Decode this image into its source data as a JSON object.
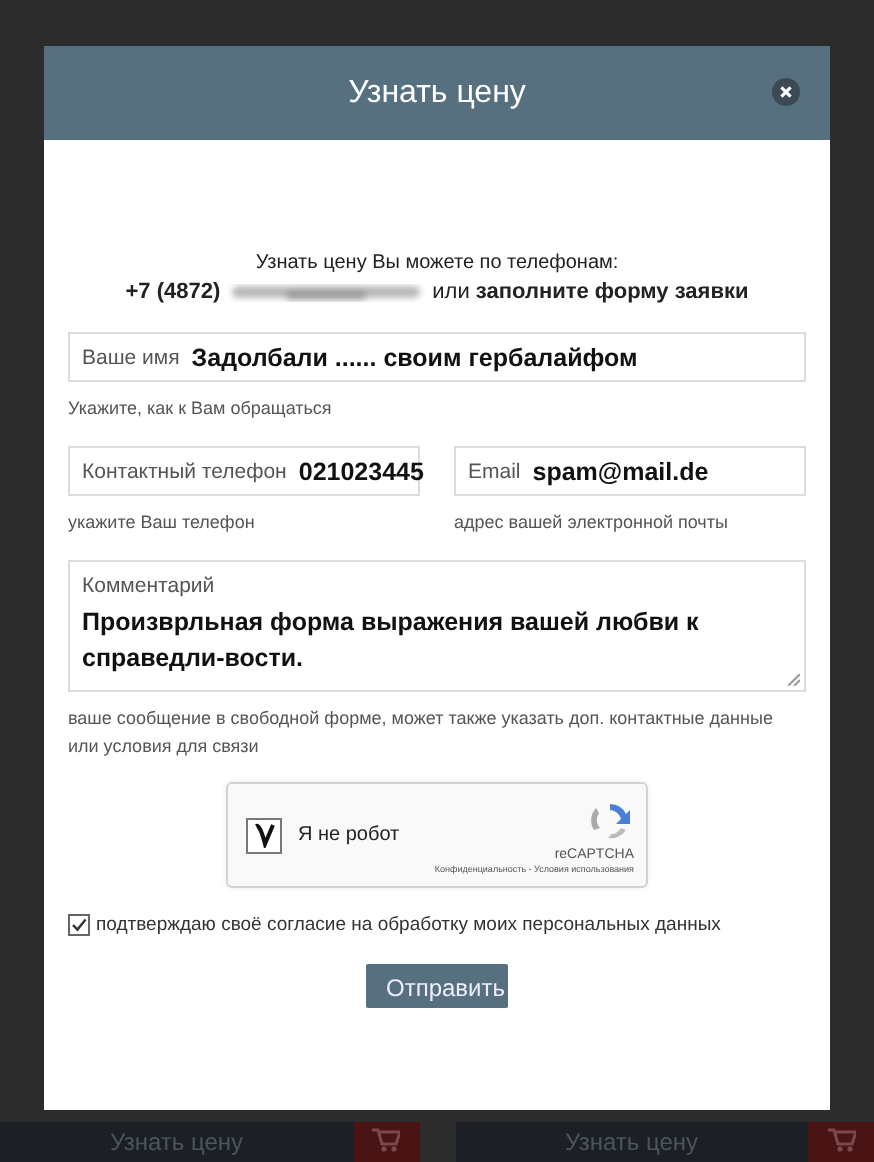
{
  "background": {
    "buttons": [
      {
        "label": "Узнать цену"
      },
      {
        "label": "Узнать цену"
      }
    ]
  },
  "modal": {
    "title": "Узнать цену",
    "intro": "Узнать цену Вы можете по телефонам:",
    "phone": "+7 (4872)",
    "alternative": "или **заполните форму заявки**",
    "field_rows": [
      [
        {
          "kind": "input",
          "label": "Ваше имя",
          "value": "Задолбали ...... своим гербалайфом",
          "hint": "Укажите, как к Вам обращаться"
        }
      ],
      [
        {
          "kind": "input",
          "label": "Контактный телефон",
          "value": "021023445",
          "hint": "укажите Ваш телефон"
        },
        {
          "kind": "input",
          "label": "Email",
          "value": "spam@mail.de",
          "hint": "адрес вашей электронной почты"
        }
      ],
      [
        {
          "kind": "textarea",
          "label": "Комментарий",
          "value": "Произврльная форма выражения вашей любви к справедли-вости.",
          "hint": "ваше сообщение в свободной форме, может также указать доп. контактные данные или условия для связи"
        }
      ]
    ],
    "captcha": {
      "checked": true,
      "label": "Я не робот",
      "brand": "reCAPTCHA",
      "links": "Конфиденциальность - Условия использования"
    },
    "consent": {
      "checked": true,
      "label": "подтверждаю своё согласие на обработку моих персональных данных"
    },
    "submit": "Отправить"
  }
}
